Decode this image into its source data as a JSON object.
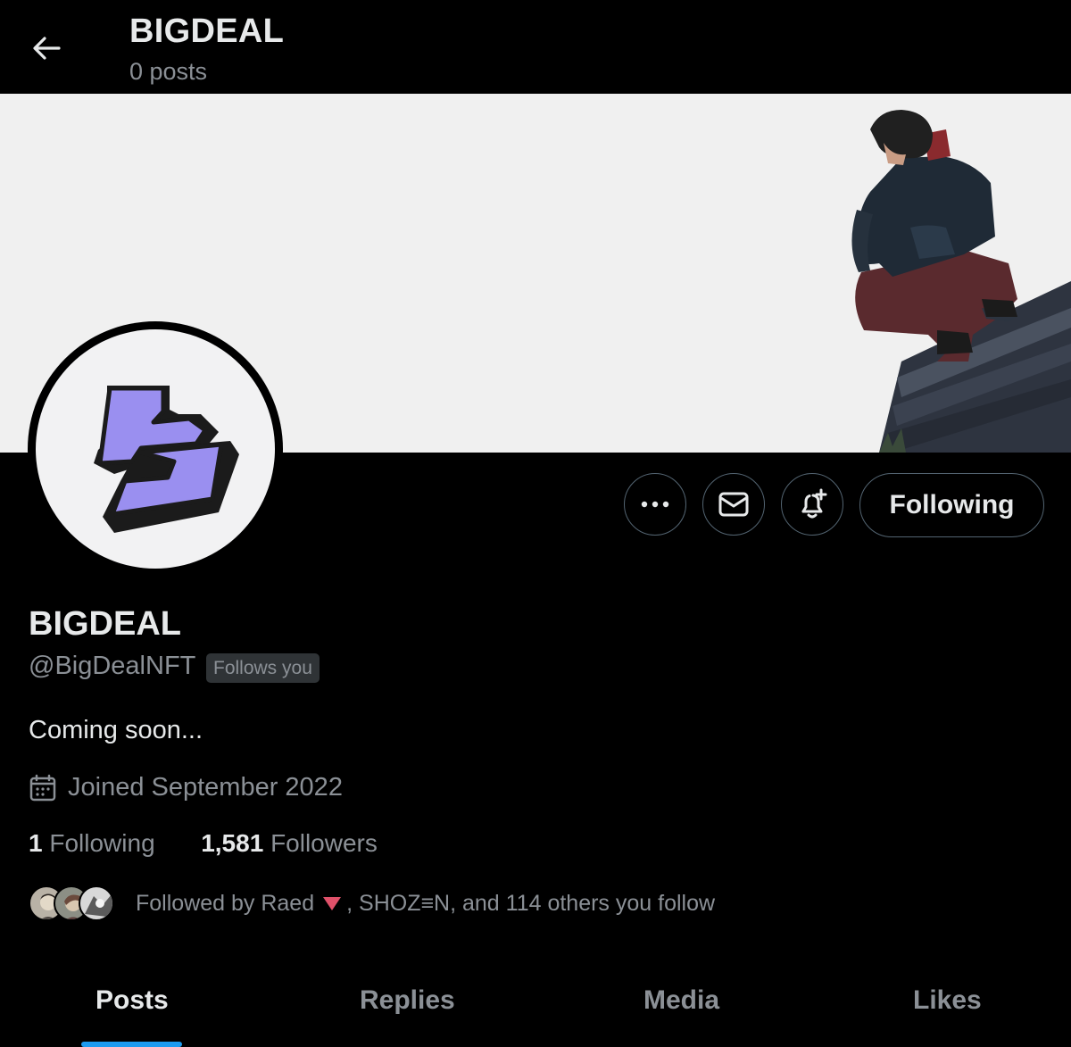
{
  "header": {
    "title": "BIGDEAL",
    "subtitle": "0 posts"
  },
  "profile": {
    "name": "BIGDEAL",
    "handle": "@BigDealNFT",
    "follows_you_badge": "Follows you",
    "bio": "Coming soon...",
    "joined": "Joined September 2022",
    "following_count": "1",
    "following_label": "Following",
    "followers_count": "1,581",
    "followers_label": "Followers",
    "followed_by_prefix": "Followed by Raed",
    "followed_by_rest": ", SHOZ≡N, and 114 others you follow"
  },
  "actions": {
    "more_icon": "more-icon",
    "message_icon": "envelope-icon",
    "notify_icon": "bell-plus-icon",
    "following_button": "Following"
  },
  "tabs": [
    {
      "label": "Posts",
      "active": true
    },
    {
      "label": "Replies",
      "active": false
    },
    {
      "label": "Media",
      "active": false
    },
    {
      "label": "Likes",
      "active": false
    }
  ],
  "colors": {
    "background": "#000000",
    "banner": "#f0f0f0",
    "logo_purple": "#9a8ff0",
    "tab_indicator": "#1d9bf0",
    "muted_text": "#8b9096",
    "raed_triangle": "#e0516a"
  }
}
